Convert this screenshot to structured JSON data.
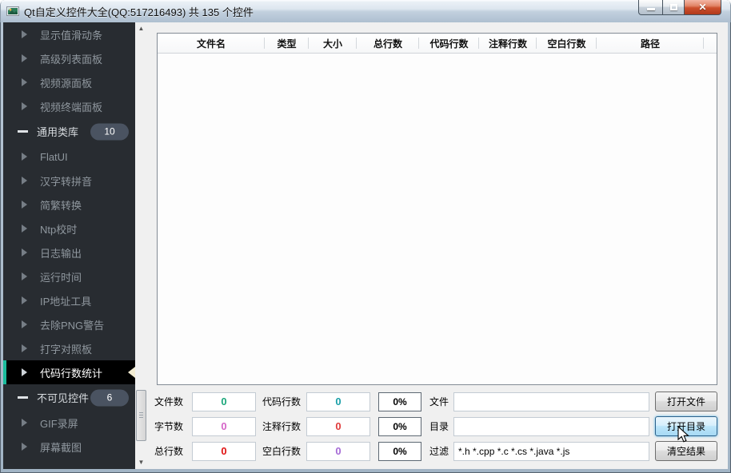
{
  "window": {
    "title": "Qt自定义控件大全(QQ:517216493) 共 135 个控件"
  },
  "icons": {
    "window_icon": "picture-icon",
    "minimize": "minimize-bar",
    "maximize": "restore-square",
    "close": "✕",
    "expand_arrow": "right-triangle",
    "collapse": "minus-bar",
    "selected_marker": "left-triangle",
    "scroll_up": "▲",
    "scroll_down": "▼"
  },
  "sidebar": {
    "accent_color": "#1abc9c",
    "items": [
      {
        "label": "显示值滑动条",
        "type": "child"
      },
      {
        "label": "高级列表面板",
        "type": "child"
      },
      {
        "label": "视频源面板",
        "type": "child"
      },
      {
        "label": "视频终端面板",
        "type": "child"
      },
      {
        "label": "通用类库",
        "type": "group",
        "badge": "10"
      },
      {
        "label": "FlatUI",
        "type": "child"
      },
      {
        "label": "汉字转拼音",
        "type": "child"
      },
      {
        "label": "简繁转换",
        "type": "child"
      },
      {
        "label": "Ntp校时",
        "type": "child"
      },
      {
        "label": "日志输出",
        "type": "child"
      },
      {
        "label": "运行时间",
        "type": "child"
      },
      {
        "label": "IP地址工具",
        "type": "child"
      },
      {
        "label": "去除PNG警告",
        "type": "child"
      },
      {
        "label": "打字对照板",
        "type": "child"
      },
      {
        "label": "代码行数统计",
        "type": "child",
        "selected": true
      },
      {
        "label": "不可见控件",
        "type": "group",
        "badge": "6"
      },
      {
        "label": "GIF录屏",
        "type": "child"
      },
      {
        "label": "屏幕截图",
        "type": "child"
      }
    ]
  },
  "table": {
    "columns": [
      "文件名",
      "类型",
      "大小",
      "总行数",
      "代码行数",
      "注释行数",
      "空白行数",
      "路径"
    ]
  },
  "stats": {
    "rows": [
      {
        "label1": "文件数",
        "value1": "0",
        "color1": "#1ca77c",
        "label2": "代码行数",
        "value2": "0",
        "color2": "#1a9fa8",
        "percent": "0%",
        "label3": "文件",
        "input": "",
        "button": "打开文件",
        "button_active": false
      },
      {
        "label1": "字节数",
        "value1": "0",
        "color1": "#d565c8",
        "label2": "注释行数",
        "value2": "0",
        "color2": "#e03b3b",
        "percent": "0%",
        "label3": "目录",
        "input": "",
        "button": "打开目录",
        "button_active": true
      },
      {
        "label1": "总行数",
        "value1": "0",
        "color1": "#e01212",
        "label2": "空白行数",
        "value2": "0",
        "color2": "#a56ad6",
        "percent": "0%",
        "label3": "过滤",
        "input": "*.h *.cpp *.c *.cs *.java *.js",
        "button": "清空结果",
        "button_active": false
      }
    ]
  }
}
